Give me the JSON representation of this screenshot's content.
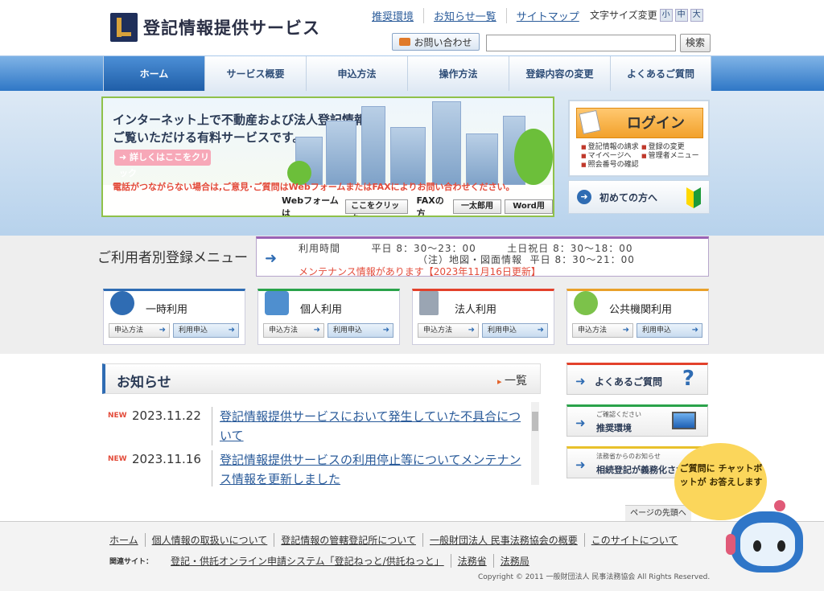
{
  "header": {
    "logo_text": "登記情報提供サービス",
    "toplinks": [
      "推奨環境",
      "お知らせ一覧",
      "サイトマップ"
    ],
    "font_size_label": "文字サイズ変更",
    "font_sizes": [
      "小",
      "中",
      "大"
    ],
    "contact_label": "お問い合わせ",
    "search_value": "",
    "search_button": "検索"
  },
  "nav": {
    "items": [
      "ホーム",
      "サービス概要",
      "申込方法",
      "操作方法",
      "登録内容の変更",
      "よくあるご質問"
    ],
    "active_index": 0
  },
  "banner": {
    "title_line1": "インターネット上で不動産および法人登記情報を",
    "title_line2": "ご覧いただける有料サービスです。",
    "detail_button": "➜ 詳しくはここをクリック",
    "warning": "電話がつながらない場合は,ご意見･ご質問はWebフォームまたはFAXによりお問い合わせください。",
    "web_label": "Webフォームは",
    "web_button": "ここをクリック",
    "fax_label": "FAXの方",
    "fax_button1": "一太郎用",
    "fax_button2": "Word用"
  },
  "login": {
    "button": "ログイン",
    "items": [
      "登記情報の請求",
      "登録の変更",
      "マイページへ",
      "管理者メニュー",
      "照会番号の確認"
    ]
  },
  "first_time": {
    "label": "初めての方へ"
  },
  "registration": {
    "title": "ご利用者別登録メニュー",
    "hours_line1": "利用時間        平日 8：30～23：00        土日祝日 8：30～18：00",
    "hours_line2": "（注）地図・図面情報  平日 8：30～21：00",
    "maintenance": "メンテナンス情報があります【2023年11月16日更新】",
    "cards": [
      {
        "title": "一時利用",
        "btn1": "申込方法",
        "btn2": "利用申込",
        "icon": "time-icon",
        "accent": "#2f6cb3"
      },
      {
        "title": "個人利用",
        "btn1": "申込方法",
        "btn2": "利用申込",
        "icon": "house-icon",
        "accent": "#2aa34a"
      },
      {
        "title": "法人利用",
        "btn1": "申込方法",
        "btn2": "利用申込",
        "icon": "building-icon",
        "accent": "#e3412b"
      },
      {
        "title": "公共機関利用",
        "btn1": "申込方法",
        "btn2": "利用申込",
        "icon": "map-icon",
        "accent": "#e9a12b"
      }
    ]
  },
  "news": {
    "title": "お知らせ",
    "more": "一覧",
    "items": [
      {
        "badge": "NEW",
        "date": "2023.11.22",
        "text": "登記情報提供サービスにおいて発生していた不具合について"
      },
      {
        "badge": "NEW",
        "date": "2023.11.16",
        "text": "登記情報提供サービスの利用停止等についてメンテナンス情報を更新しました"
      }
    ]
  },
  "side": {
    "faq": "よくあるご質問",
    "env_sub": "ご確認ください",
    "env": "推奨環境",
    "notice_sub": "法務省からのお知らせ",
    "notice": "相続登記が義務化されます"
  },
  "chatbot": {
    "text": "ご質問に チャットボットが お答えします"
  },
  "footer": {
    "pagetop": "ページの先頭へ",
    "links": [
      "ホーム",
      "個人情報の取扱いについて",
      "登記情報の管轄登記所について",
      "一般財団法人 民事法務協会の概要",
      "このサイトについて"
    ],
    "related_label": "関連サイト：",
    "related": [
      "登記・供託オンライン申請システム「登記ねっと/供託ねっと」",
      "法務省",
      "法務局"
    ],
    "copyright": "Copyright © 2011 一般財団法人 民事法務協会 All Rights Reserved."
  }
}
